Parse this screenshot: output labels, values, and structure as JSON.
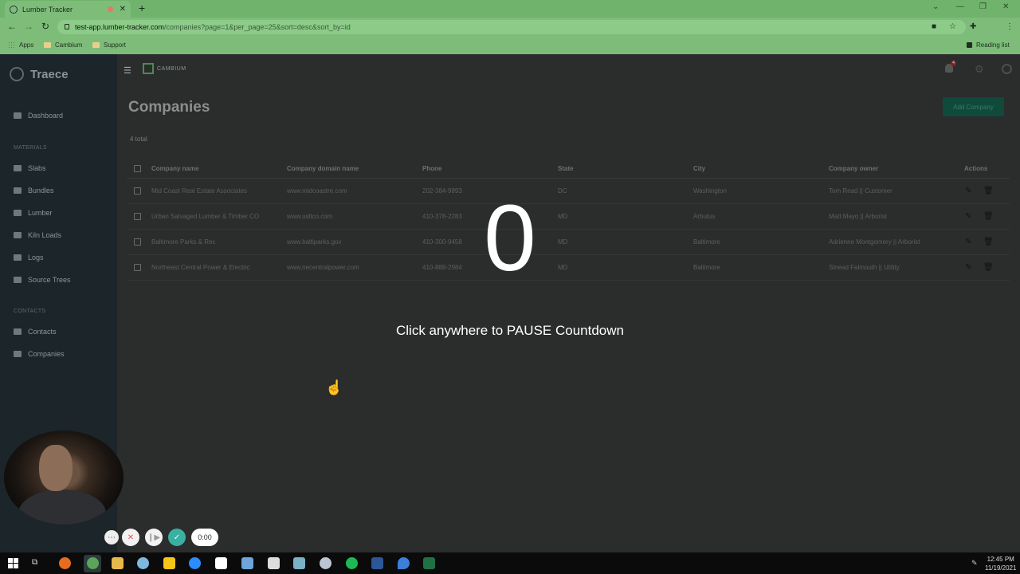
{
  "browser": {
    "tab_title": "Lumber Tracker",
    "url_host": "test-app.lumber-tracker.com",
    "url_path": "/companies?page=1&per_page=25&sort=desc&sort_by=id",
    "bookmarks": [
      "Apps",
      "Cambium",
      "Support"
    ],
    "reading_list": "Reading list"
  },
  "sidebar": {
    "brand": "Traece",
    "dashboard": "Dashboard",
    "materials_heading": "MATERIALS",
    "materials": [
      "Slabs",
      "Bundles",
      "Lumber",
      "Kiln Loads",
      "Logs",
      "Source Trees"
    ],
    "contacts_heading": "CONTACTS",
    "contacts": [
      "Contacts",
      "Companies"
    ]
  },
  "header": {
    "logo_text": "CAMBIUM",
    "notification_count": "4"
  },
  "page": {
    "title": "Companies",
    "add_button": "Add Company",
    "total": "4 total"
  },
  "table": {
    "columns": [
      "Company name",
      "Company domain name",
      "Phone",
      "State",
      "City",
      "Company owner",
      "Actions"
    ],
    "rows": [
      [
        "Mid Coast Real Estate Associates",
        "www.midcoastre.com",
        "202-384-9893",
        "DC",
        "Washington",
        "Tom Read || Customer"
      ],
      [
        "Urban Salvaged Lumber & Timber CO",
        "www.usltco.com",
        "410-378-2283",
        "MD",
        "Arbutus",
        "Matt Mayo || Arborist"
      ],
      [
        "Baltimore Parks & Rec",
        "www.baltiparks.gov",
        "410-300-9458",
        "MD",
        "Baltimore",
        "Adrienne Montgomery || Arborist"
      ],
      [
        "Northeast Central Power & Electric",
        "www.necentralpower.com",
        "410-888-2984",
        "MD",
        "Baltimore",
        "Sinead Falmouth || Utility"
      ]
    ]
  },
  "overlay": {
    "countdown": "0",
    "message": "Click anywhere to PAUSE Countdown"
  },
  "recorder": {
    "timer": "0:00"
  },
  "taskbar": {
    "time": "12:45 PM",
    "date": "11/19/2021"
  }
}
